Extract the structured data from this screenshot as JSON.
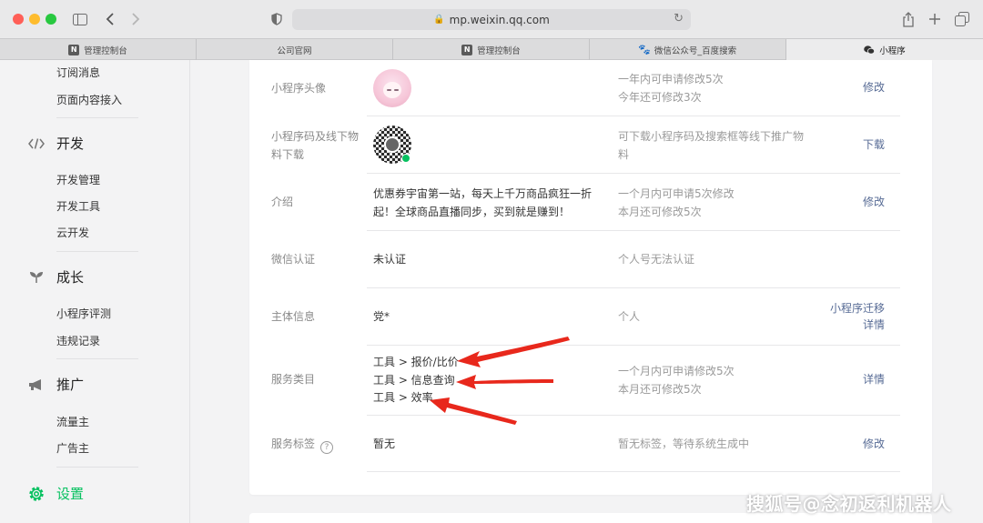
{
  "browser": {
    "url": "mp.weixin.qq.com",
    "tabs": [
      {
        "label": "管理控制台",
        "favicon": "N",
        "active": false
      },
      {
        "label": "公司官网",
        "favicon": "",
        "active": false
      },
      {
        "label": "管理控制台",
        "favicon": "N",
        "active": false
      },
      {
        "label": "微信公众号_百度搜索",
        "favicon": "paw",
        "active": false
      },
      {
        "label": "小程序",
        "favicon": "wechat",
        "active": true
      }
    ]
  },
  "sidebar": {
    "top_items": [
      "订阅消息",
      "页面内容接入"
    ],
    "groups": [
      {
        "label": "开发",
        "icon": "code-icon",
        "items": [
          "开发管理",
          "开发工具",
          "云开发"
        ]
      },
      {
        "label": "成长",
        "icon": "sprout-icon",
        "items": [
          "小程序评测",
          "违规记录"
        ]
      },
      {
        "label": "推广",
        "icon": "megaphone-icon",
        "items": [
          "流量主",
          "广告主"
        ]
      },
      {
        "label": "设置",
        "icon": "gear-icon",
        "items": []
      }
    ],
    "active_color": "#07c160"
  },
  "settings": {
    "rows": [
      {
        "label": "小程序头像",
        "value": "",
        "note": "一年内可申请修改5次\n今年还可修改3次",
        "actions": [
          "修改"
        ]
      },
      {
        "label": "小程序码及线下物料下载",
        "value": "",
        "note": "可下载小程序码及搜索框等线下推广物料",
        "actions": [
          "下载"
        ]
      },
      {
        "label": "介绍",
        "value": "优惠券宇宙第一站，每天上千万商品疯狂一折起！全球商品直播同步，买到就是赚到！",
        "note": "一个月内可申请5次修改\n本月还可修改5次",
        "actions": [
          "修改"
        ]
      },
      {
        "label": "微信认证",
        "value": "未认证",
        "note": "个人号无法认证",
        "actions": []
      },
      {
        "label": "主体信息",
        "value": "党*",
        "note": "个人",
        "actions": [
          "小程序迁移",
          "详情"
        ]
      },
      {
        "label": "服务类目",
        "value": "工具 > 报价/比价\n工具 > 信息查询\n工具 > 效率",
        "note": "一个月内可申请修改5次\n本月还可修改5次",
        "actions": [
          "详情"
        ]
      },
      {
        "label": "服务标签",
        "value": "暂无",
        "note": "暂无标签，等待系统生成中",
        "actions": [
          "修改"
        ],
        "help": "?"
      }
    ]
  },
  "watermark": "搜狐号@念初返利机器人",
  "accent_link_color": "#576b95",
  "annotation_color": "#e8281c"
}
